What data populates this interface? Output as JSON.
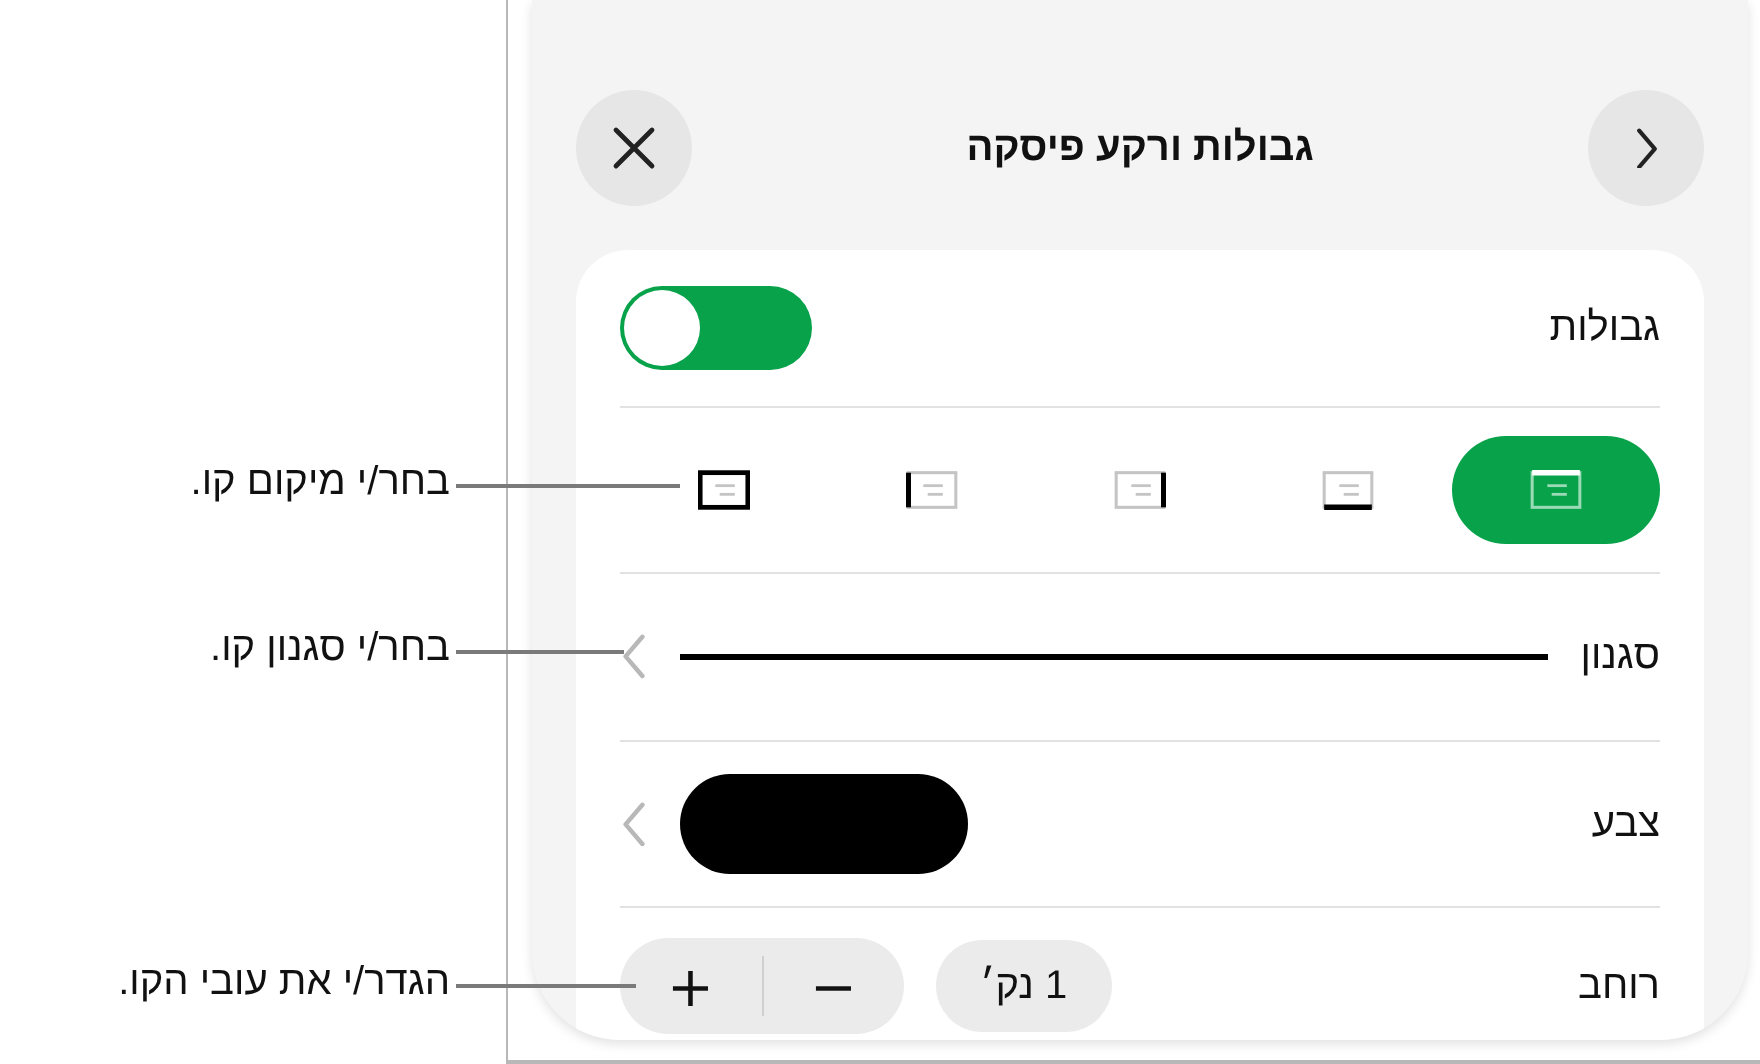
{
  "callouts": [
    {
      "text": "בחר/י מיקום קו."
    },
    {
      "text": "בחר/י סגנון קו."
    },
    {
      "text": "הגדר/י את עובי הקו."
    }
  ],
  "panel": {
    "title": "גבולות ורקע פיסקה"
  },
  "borders": {
    "label": "גבולות",
    "on": true
  },
  "positions": [
    {
      "kind": "top",
      "selected": true
    },
    {
      "kind": "bottom",
      "selected": false
    },
    {
      "kind": "right",
      "selected": false
    },
    {
      "kind": "left",
      "selected": false
    },
    {
      "kind": "all",
      "selected": false
    }
  ],
  "style": {
    "label": "סגנון"
  },
  "color": {
    "label": "צבע",
    "color": "#000000"
  },
  "width": {
    "label": "רוחב",
    "value": "1 נק׳",
    "decrease": "−",
    "increase": "+"
  }
}
